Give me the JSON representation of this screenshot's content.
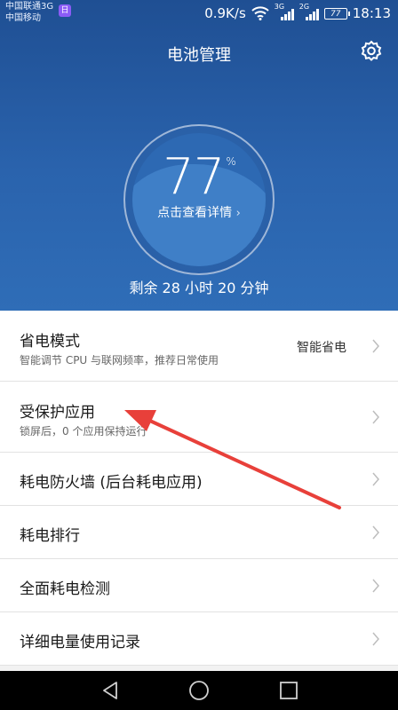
{
  "status_bar": {
    "carrier1": "中国联通3G",
    "carrier2": "中国移动",
    "carrier_icon_text": "日",
    "speed": "0.9K/s",
    "signal1_label": "3G",
    "signal2_label": "2G",
    "battery": "77",
    "time": "18:13"
  },
  "header": {
    "title": "电池管理"
  },
  "gauge": {
    "value": "77",
    "unit": "%",
    "link_text": "点击查看详情",
    "level": 0.77
  },
  "remaining": "剩余 28 小时 20 分钟",
  "list": {
    "items": [
      {
        "title": "省电模式",
        "subtitle": "智能调节 CPU 与联网频率，推荐日常使用",
        "value": "智能省电"
      },
      {
        "title": "受保护应用",
        "subtitle": "锁屏后，0 个应用保持运行"
      },
      {
        "title": "耗电防火墙 (后台耗电应用)"
      },
      {
        "title": "耗电排行"
      },
      {
        "title": "全面耗电检测"
      },
      {
        "title": "详细电量使用记录"
      }
    ]
  },
  "colors": {
    "header_bg": "#2a63ad",
    "annotation_arrow": "#e8403a"
  },
  "icons": {
    "settings": "gear-icon",
    "row_chevron": "chevron-right-icon",
    "nav_back": "back-triangle-icon",
    "nav_home": "home-circle-icon",
    "nav_recent": "recent-square-icon"
  }
}
